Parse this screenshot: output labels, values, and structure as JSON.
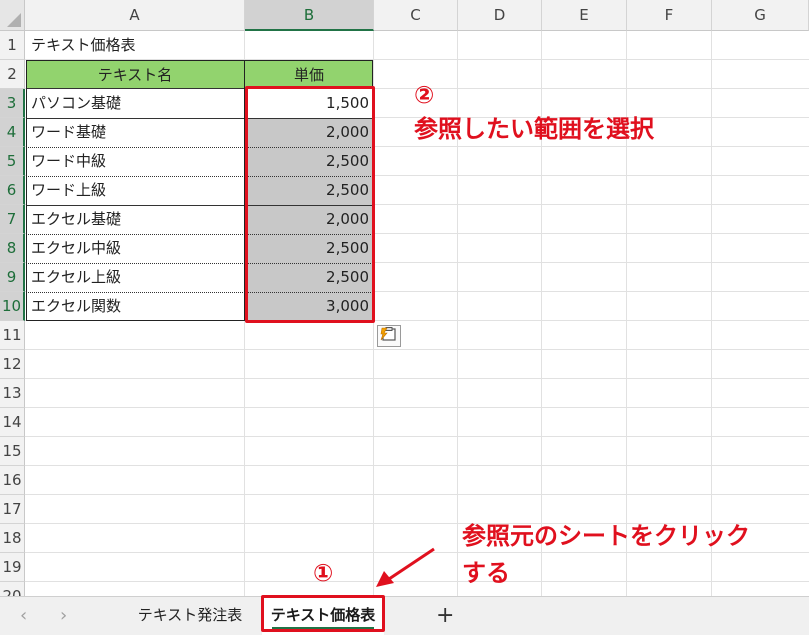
{
  "columns": [
    "A",
    "B",
    "C",
    "D",
    "E",
    "F",
    "G"
  ],
  "rows": [
    "1",
    "2",
    "3",
    "4",
    "5",
    "6",
    "7",
    "8",
    "9",
    "10",
    "11",
    "12",
    "13",
    "14",
    "15",
    "16",
    "17",
    "18",
    "19",
    "20"
  ],
  "title_cell": "テキスト価格表",
  "table_header": {
    "name": "テキスト名",
    "price": "単価"
  },
  "table_rows": [
    {
      "name": "パソコン基礎",
      "price": "1,500"
    },
    {
      "name": "ワード基礎",
      "price": "2,000"
    },
    {
      "name": "ワード中級",
      "price": "2,500"
    },
    {
      "name": "ワード上級",
      "price": "2,500"
    },
    {
      "name": "エクセル基礎",
      "price": "2,000"
    },
    {
      "name": "エクセル中級",
      "price": "2,500"
    },
    {
      "name": "エクセル上級",
      "price": "2,500"
    },
    {
      "name": "エクセル関数",
      "price": "3,000"
    }
  ],
  "annotation_2": {
    "number": "②",
    "text": "参照したい範囲を選択"
  },
  "annotation_1": {
    "number": "①",
    "text_line1": "参照元のシートをクリック",
    "text_line2": "する"
  },
  "sheet_tabs": [
    {
      "label": "テキスト発注表",
      "active": false
    },
    {
      "label": "テキスト価格表",
      "active": true
    }
  ],
  "nav": {
    "prev": "‹",
    "next": "›",
    "add": "+"
  },
  "colors": {
    "header_green": "#92d36e",
    "selection_gray": "#c8c8c8",
    "annotation_red": "#e0101e",
    "excel_green": "#217346"
  },
  "icons": [
    "paste-options-icon",
    "arrow-icon"
  ]
}
